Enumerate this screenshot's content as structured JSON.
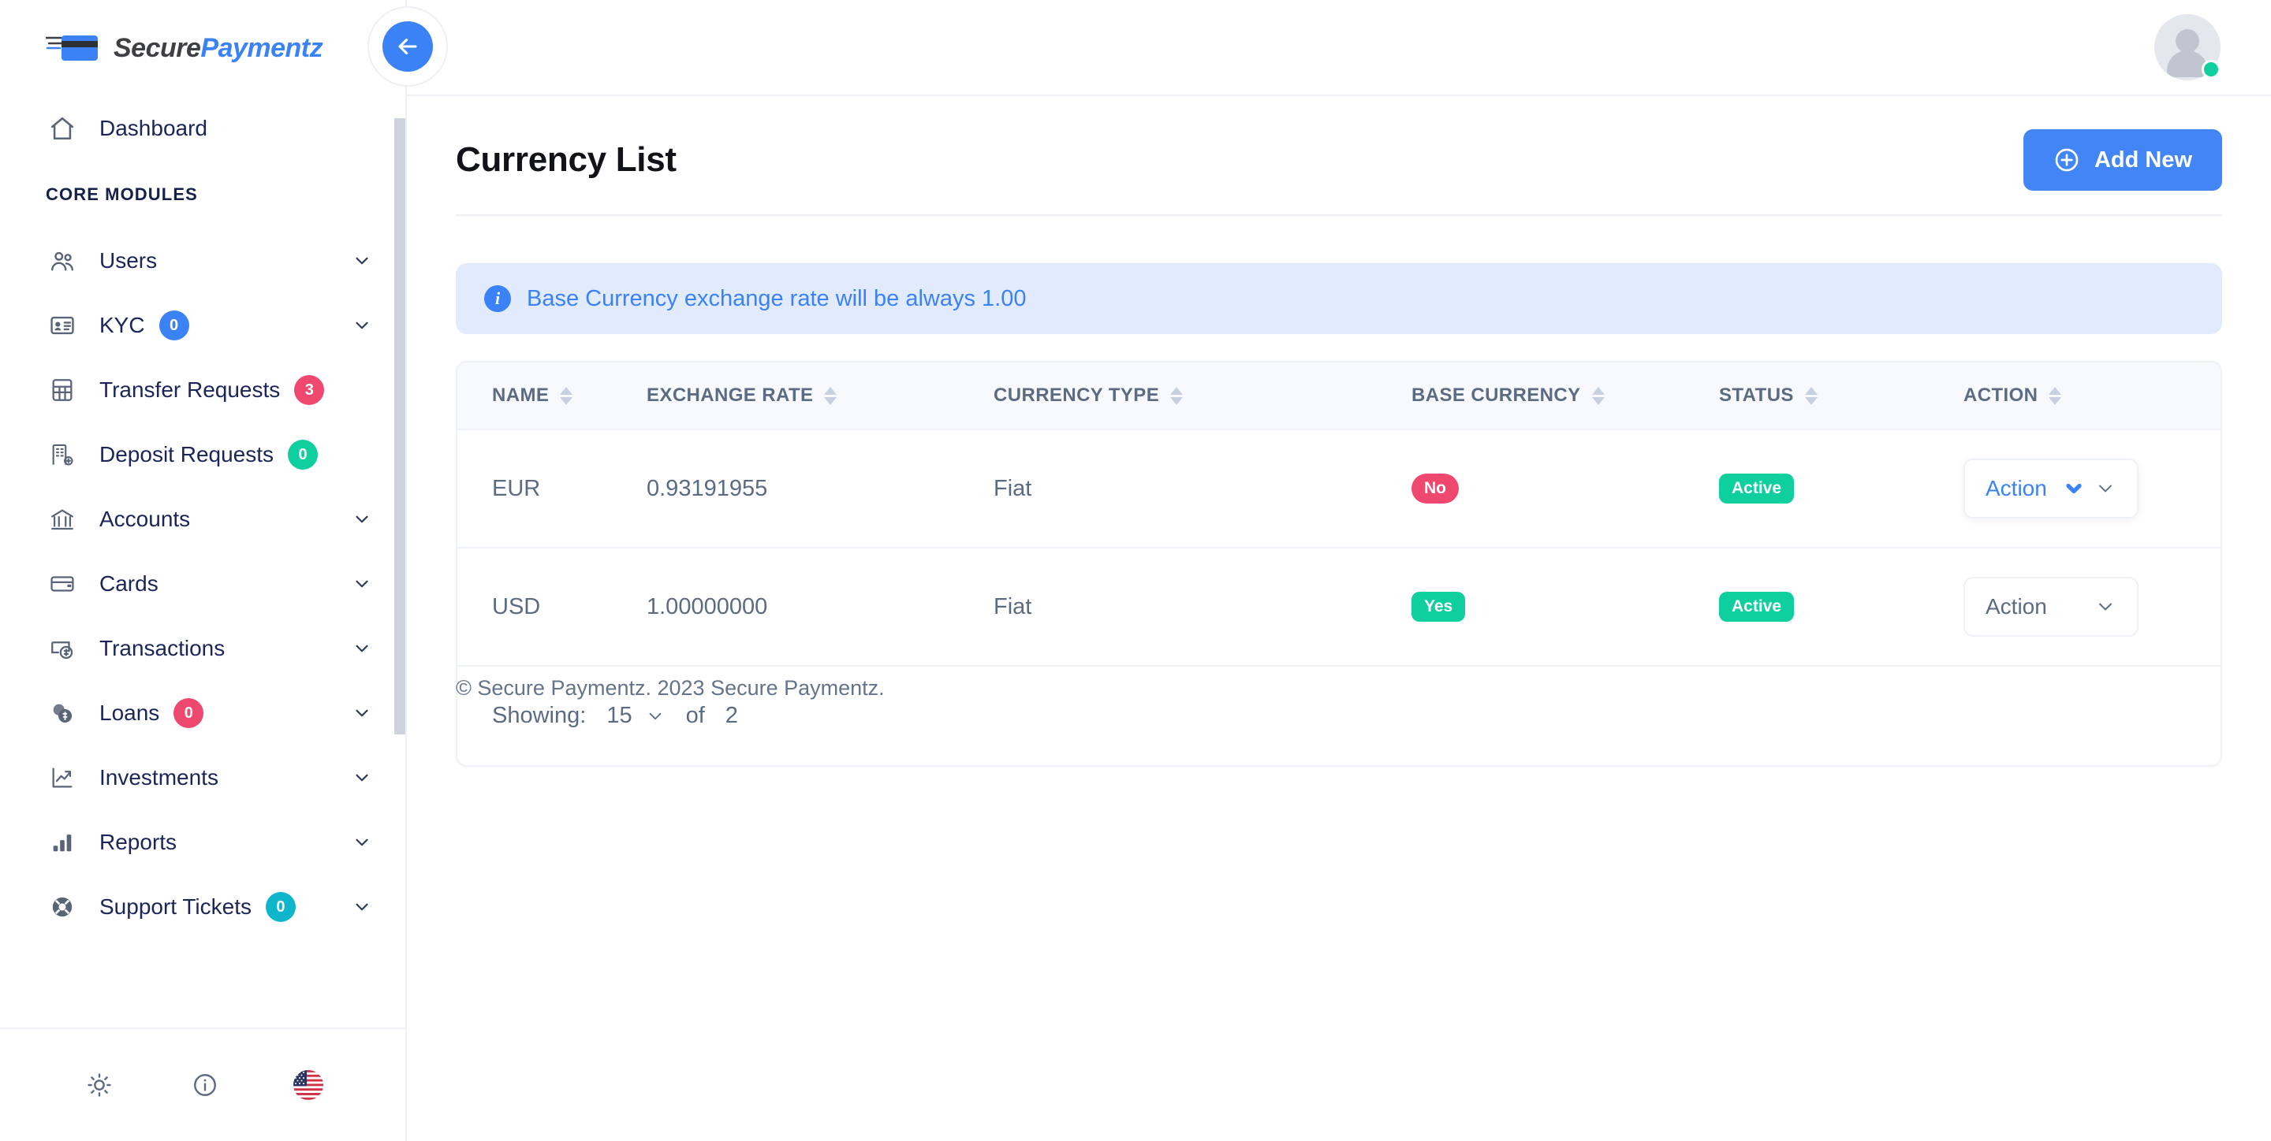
{
  "brand": {
    "name_first": "Secure",
    "name_second": "Paymentz"
  },
  "topbar": {
    "back_label": "Back",
    "back_icon": "arrow-left-icon",
    "avatar_icon": "user-avatar-icon",
    "status": "online"
  },
  "sidebar": {
    "dashboard": {
      "label": "Dashboard",
      "icon": "home-icon"
    },
    "section_label": "CORE MODULES",
    "items": [
      {
        "label": "Users",
        "icon": "users-icon",
        "badge": null,
        "badge_color": null,
        "caret": true
      },
      {
        "label": "KYC",
        "icon": "id-card-icon",
        "badge": "0",
        "badge_color": "#3b82f6",
        "caret": true
      },
      {
        "label": "Transfer Requests",
        "icon": "grid-table-icon",
        "badge": "3",
        "badge_color": "#ef486f",
        "caret": false
      },
      {
        "label": "Deposit Requests",
        "icon": "bank-building-add-icon",
        "badge": "0",
        "badge_color": "#0ecf9d",
        "caret": false
      },
      {
        "label": "Accounts",
        "icon": "bank-icon",
        "badge": null,
        "badge_color": null,
        "caret": true
      },
      {
        "label": "Cards",
        "icon": "credit-card-icon",
        "badge": null,
        "badge_color": null,
        "caret": true
      },
      {
        "label": "Transactions",
        "icon": "money-exchange-icon",
        "badge": null,
        "badge_color": null,
        "caret": true
      },
      {
        "label": "Loans",
        "icon": "coins-icon",
        "badge": "0",
        "badge_color": "#ef486f",
        "caret": true
      },
      {
        "label": "Investments",
        "icon": "trending-up-icon",
        "badge": null,
        "badge_color": null,
        "caret": true
      },
      {
        "label": "Reports",
        "icon": "bar-chart-icon",
        "badge": null,
        "badge_color": null,
        "caret": true
      },
      {
        "label": "Support Tickets",
        "icon": "life-buoy-icon",
        "badge": "0",
        "badge_color": "#0fb5ca",
        "caret": true
      }
    ],
    "footer_buttons": [
      {
        "name": "theme-toggle",
        "icon": "sun-icon"
      },
      {
        "name": "info",
        "icon": "info-circle-icon"
      },
      {
        "name": "language",
        "icon": "us-flag-icon"
      }
    ]
  },
  "page": {
    "title": "Currency List",
    "add_new_label": "Add New",
    "add_new_icon": "plus-circle-icon",
    "alert": {
      "icon": "info-icon",
      "text": "Base Currency exchange rate will be always 1.00"
    }
  },
  "table": {
    "columns": [
      "NAME",
      "EXCHANGE RATE",
      "CURRENCY TYPE",
      "BASE CURRENCY",
      "STATUS",
      "ACTION"
    ],
    "rows": [
      {
        "name": "EUR",
        "exchange_rate": "0.93191955",
        "currency_type": "Fiat",
        "base_currency": "No",
        "base_currency_state": "no",
        "status": "Active",
        "action_label": "Action",
        "action_state": "active"
      },
      {
        "name": "USD",
        "exchange_rate": "1.00000000",
        "currency_type": "Fiat",
        "base_currency": "Yes",
        "base_currency_state": "yes",
        "status": "Active",
        "action_label": "Action",
        "action_state": "default"
      }
    ],
    "pagination": {
      "showing_label": "Showing:",
      "page_size": "15",
      "of_label": "of",
      "total": "2"
    }
  },
  "footer": {
    "text": "© Secure Paymentz. 2023 Secure Paymentz."
  },
  "colors": {
    "accent": "#3b82f6",
    "primary_button": "#4285f4",
    "danger": "#ef486f",
    "success": "#0ecf9d",
    "info_badge": "#0fb5ca",
    "alert_bg": "#e2eafd",
    "text_muted": "#5b6b84"
  }
}
